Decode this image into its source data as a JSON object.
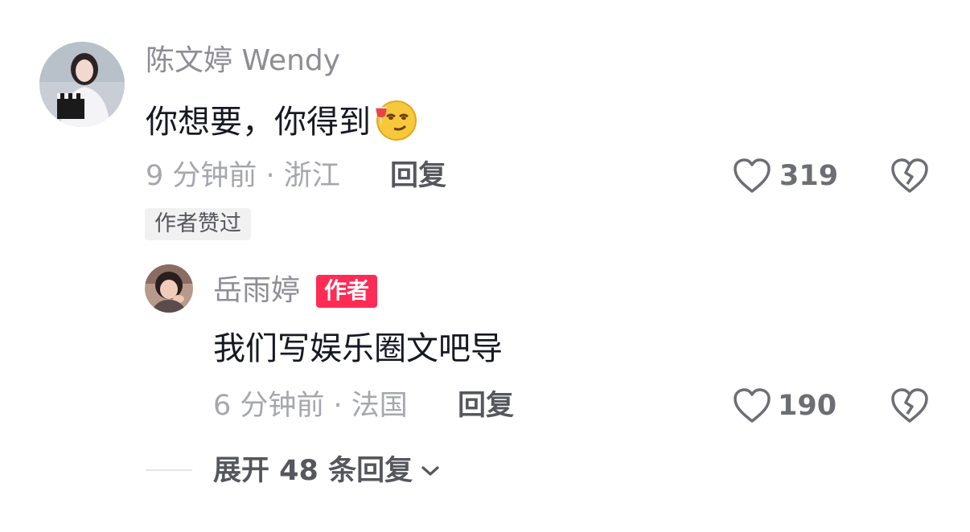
{
  "comment": {
    "username": "陈文婷 Wendy",
    "text": "你想要，你得到",
    "emoji_icon": "smirk-with-wine-emoji",
    "time_location": "9 分钟前 · 浙江",
    "reply_label": "回复",
    "like_count": "319",
    "author_liked_badge": "作者赞过"
  },
  "reply": {
    "username": "岳雨婷",
    "author_badge": "作者",
    "text": "我们写娱乐圈文吧导",
    "time_location": "6 分钟前 · 法国",
    "reply_label": "回复",
    "like_count": "190"
  },
  "expand": {
    "label": "展开 48 条回复"
  },
  "colors": {
    "author_badge_bg": "#fe2c55",
    "muted_text": "#8d8d95",
    "primary_text": "#161823"
  }
}
